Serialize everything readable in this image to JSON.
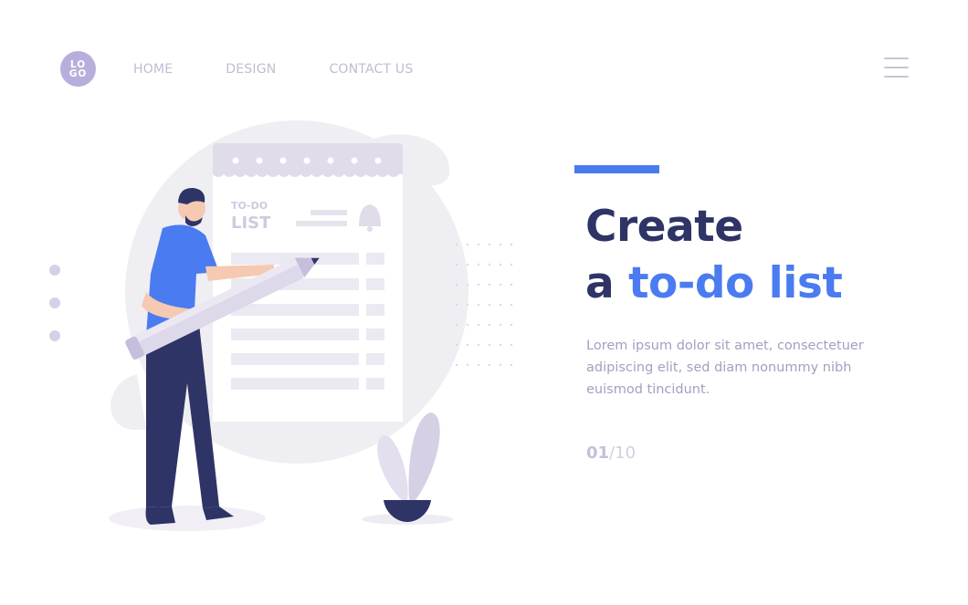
{
  "header": {
    "logo_line1": "LO",
    "logo_line2": "GO",
    "nav": [
      "HOME",
      "DESIGN",
      "CONTACT US"
    ]
  },
  "illustration": {
    "todo_title_small": "TO-DO",
    "todo_title_big": "LIST"
  },
  "hero": {
    "title_line1": "Create",
    "title_line2_prefix": "a ",
    "title_line2_highlight": "to-do list",
    "description": "Lorem ipsum dolor sit amet, consectetuer adipiscing elit, sed diam nonummy nibh euismod tincidunt.",
    "page_current": "01",
    "page_total": "/10"
  },
  "colors": {
    "accent": "#4a7bf0",
    "heading": "#2f3466",
    "logo_bg": "#b9aedb"
  }
}
